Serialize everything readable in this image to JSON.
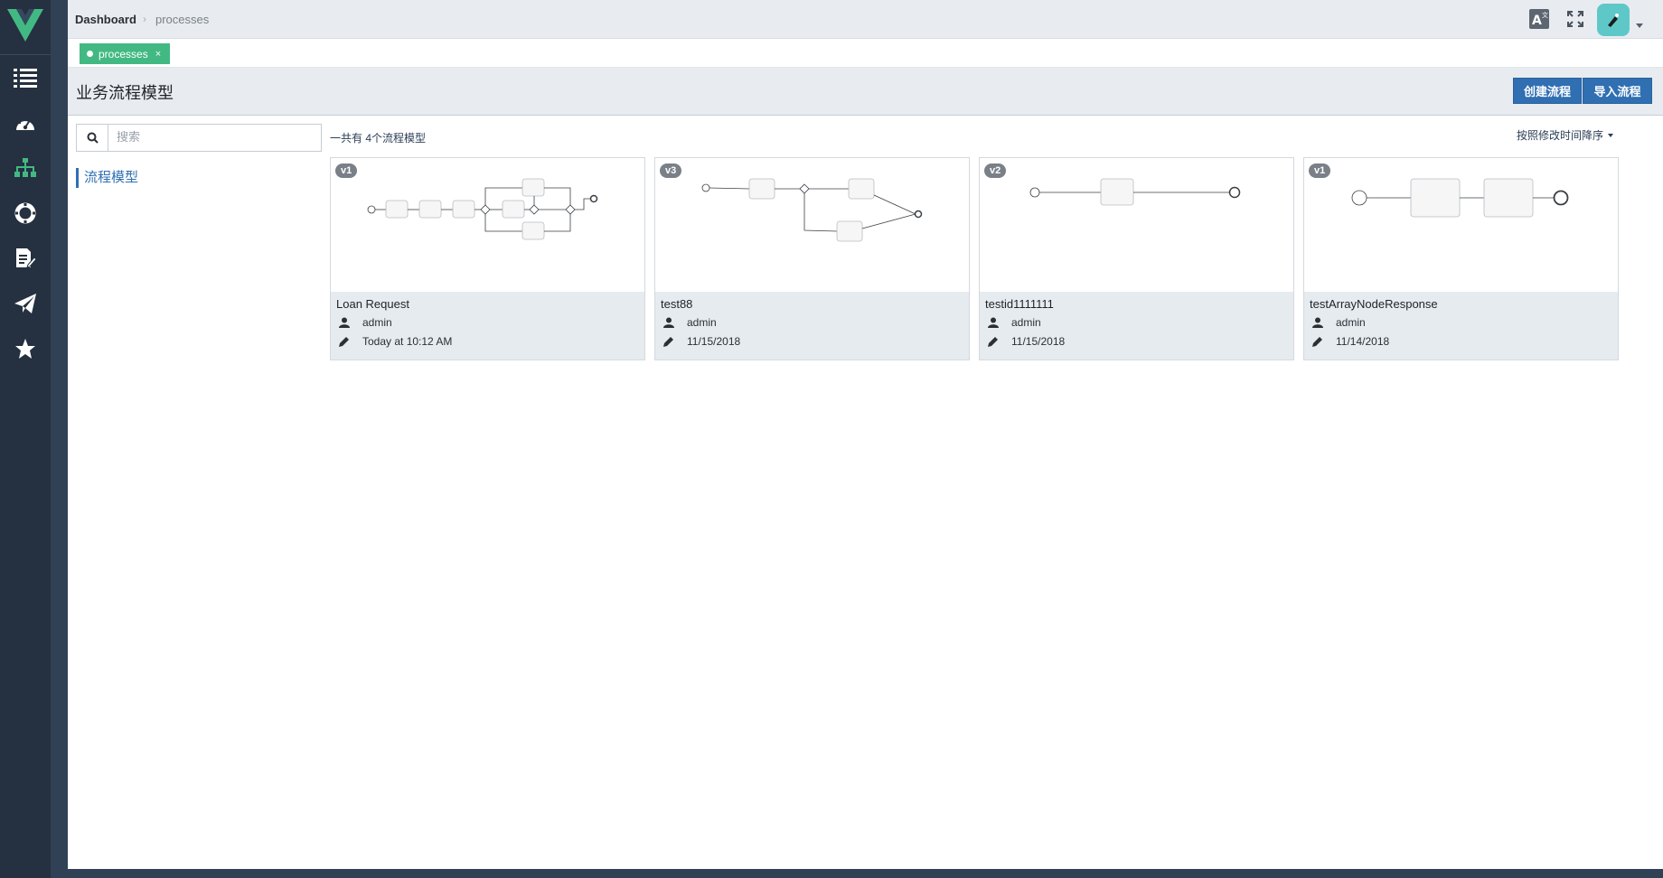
{
  "breadcrumb": {
    "root": "Dashboard",
    "separator": "›",
    "current": "processes"
  },
  "tags": [
    {
      "label": "processes",
      "close": "×"
    }
  ],
  "page": {
    "title": "业务流程模型"
  },
  "actions": {
    "create_label": "创建流程",
    "import_label": "导入流程"
  },
  "search": {
    "placeholder": "搜索",
    "value": ""
  },
  "filters": [
    {
      "label": "流程模型"
    }
  ],
  "summary": {
    "count_text": "一共有 4个流程模型",
    "sort_label": "按照修改时间降序"
  },
  "sidebar": {
    "icons": [
      "list-icon",
      "dashboard-icon",
      "sitemap-icon",
      "lifebuoy-icon",
      "edit-doc-icon",
      "send-icon",
      "star-icon"
    ],
    "active": "sitemap-icon"
  },
  "models": [
    {
      "version": "v1",
      "name": "Loan Request",
      "owner": "admin",
      "modified": "Today at 10:12 AM"
    },
    {
      "version": "v3",
      "name": "test88",
      "owner": "admin",
      "modified": "11/15/2018"
    },
    {
      "version": "v2",
      "name": "testid1111111",
      "owner": "admin",
      "modified": "11/15/2018"
    },
    {
      "version": "v1",
      "name": "testArrayNodeResponse",
      "owner": "admin",
      "modified": "11/14/2018"
    }
  ],
  "colors": {
    "sidebar": "#253040",
    "accent": "#42b983",
    "primary": "#2f6fb2",
    "avatar": "#5ec8c9"
  }
}
